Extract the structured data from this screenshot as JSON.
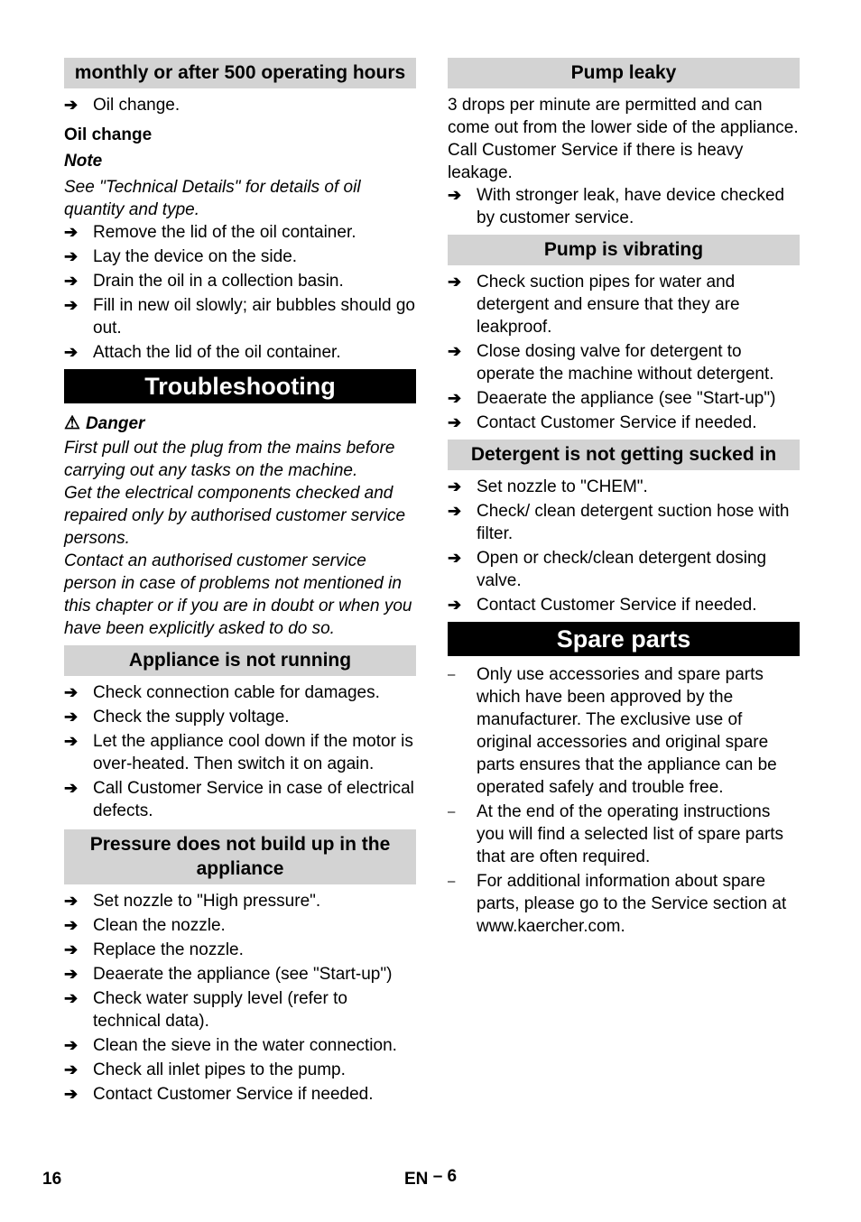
{
  "left": {
    "maint_heading": "monthly or after 500 operating hours",
    "maint_items": [
      "Oil change."
    ],
    "oil_change_title": "Oil change",
    "note_label": "Note",
    "note_text": "See \"Technical Details\" for details of oil quantity and type.",
    "oil_steps": [
      "Remove the lid of the oil container.",
      "Lay the device on the side.",
      "Drain the oil in a collection basin.",
      "Fill in new oil slowly; air bubbles should go out.",
      "Attach the lid of the oil container."
    ],
    "troubleshooting_title": "Troubleshooting",
    "danger_icon": "warning-triangle-icon",
    "danger_label": "Danger",
    "danger_paragraphs": [
      "First pull out the plug from the mains before carrying out any tasks on the machine.",
      "Get the electrical components checked and repaired only by authorised customer service persons.",
      "Contact an authorised customer service person in case of problems not mentioned in this chapter or if you are in doubt or when you have been explicitly asked to do so."
    ],
    "not_running_heading": "Appliance is not running",
    "not_running_items": [
      "Check connection cable for damages.",
      "Check the supply voltage.",
      "Let the appliance cool down if the motor is over-heated. Then switch it on again.",
      "Call Customer Service in case of electrical defects."
    ],
    "pressure_heading": "Pressure does not build up in the appliance",
    "pressure_items": [
      "Set nozzle to \"High pressure\".",
      "Clean the nozzle.",
      "Replace the nozzle.",
      "Deaerate the appliance (see \"Start-up\")",
      "Check water supply level (refer to technical data).",
      "Clean the sieve in the water connection.",
      "Check all inlet pipes to the pump.",
      "Contact Customer Service if needed."
    ]
  },
  "right": {
    "leaky_heading": "Pump leaky",
    "leaky_text": "3 drops per minute are permitted and can come out from the lower side of the appliance. Call Customer Service if there is heavy leakage.",
    "leaky_items": [
      "With stronger leak, have device checked by customer service."
    ],
    "vibrating_heading": "Pump is vibrating",
    "vibrating_items": [
      "Check suction pipes for water and detergent and ensure that they are leakproof.",
      "Close dosing valve for detergent to operate the machine without detergent.",
      "Deaerate the appliance (see \"Start-up\")",
      "Contact Customer Service if needed."
    ],
    "detergent_heading": "Detergent is not getting sucked in",
    "detergent_items": [
      "Set nozzle to \"CHEM\".",
      "Check/ clean detergent suction hose with filter.",
      "Open or check/clean detergent dosing valve.",
      "Contact Customer Service if needed."
    ],
    "spare_title": "Spare parts",
    "spare_items": [
      "Only use accessories and spare parts which have been approved by the manufacturer. The exclusive use of original accessories and original spare parts ensures that the appliance can be operated safely and trouble free.",
      "At the end of the operating instructions you will find a selected list of spare parts that are often required.",
      "For additional information about spare parts, please go to the Service section at www.kaercher.com."
    ]
  },
  "bullets": {
    "arrow": "➔",
    "dash": "–",
    "warning": "⚠"
  },
  "footer": {
    "page_number": "16",
    "section": "EN",
    "section_page": "– 6"
  }
}
